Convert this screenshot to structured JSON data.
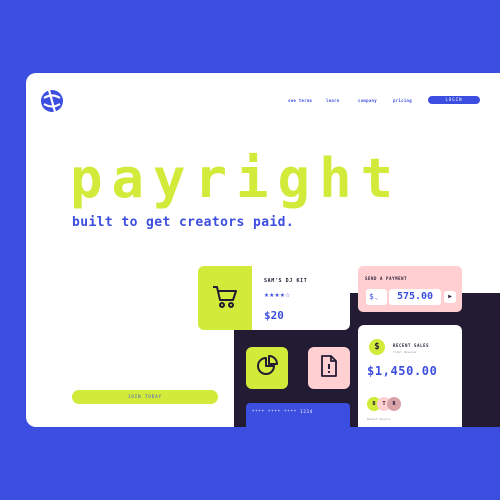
{
  "brand": {
    "logo_icon": "globe-sign-icon",
    "accent": "#3c4ee0",
    "lime": "#d2ea3a",
    "pink": "#ffcfd2",
    "dark": "#231a33"
  },
  "nav": {
    "items": [
      "see terms",
      "learn",
      "company",
      "pricing"
    ],
    "login": "LOGIN"
  },
  "hero": {
    "title": "payright",
    "subtitle": "built to get creators paid.",
    "join_button": "JOIN TODAY"
  },
  "product": {
    "icon": "cart-icon",
    "name": "SAM'S DJ KIT",
    "stars": "★★★★☆",
    "rating": 4,
    "price": "$20"
  },
  "payment": {
    "label": "SEND A PAYMENT",
    "currency": "$",
    "amount": "575.00",
    "send_icon": "play-icon"
  },
  "tiles": {
    "pie_icon": "pie-chart-icon",
    "file_icon": "file-alert-icon"
  },
  "card": {
    "number": "**** **** **** 1234"
  },
  "sales": {
    "label": "RECENT SALES",
    "sublabel": "Total Revenue",
    "amount": "$1,450.00",
    "avatars": [
      "B",
      "T",
      "R"
    ],
    "footer": "Recent Buyers"
  }
}
